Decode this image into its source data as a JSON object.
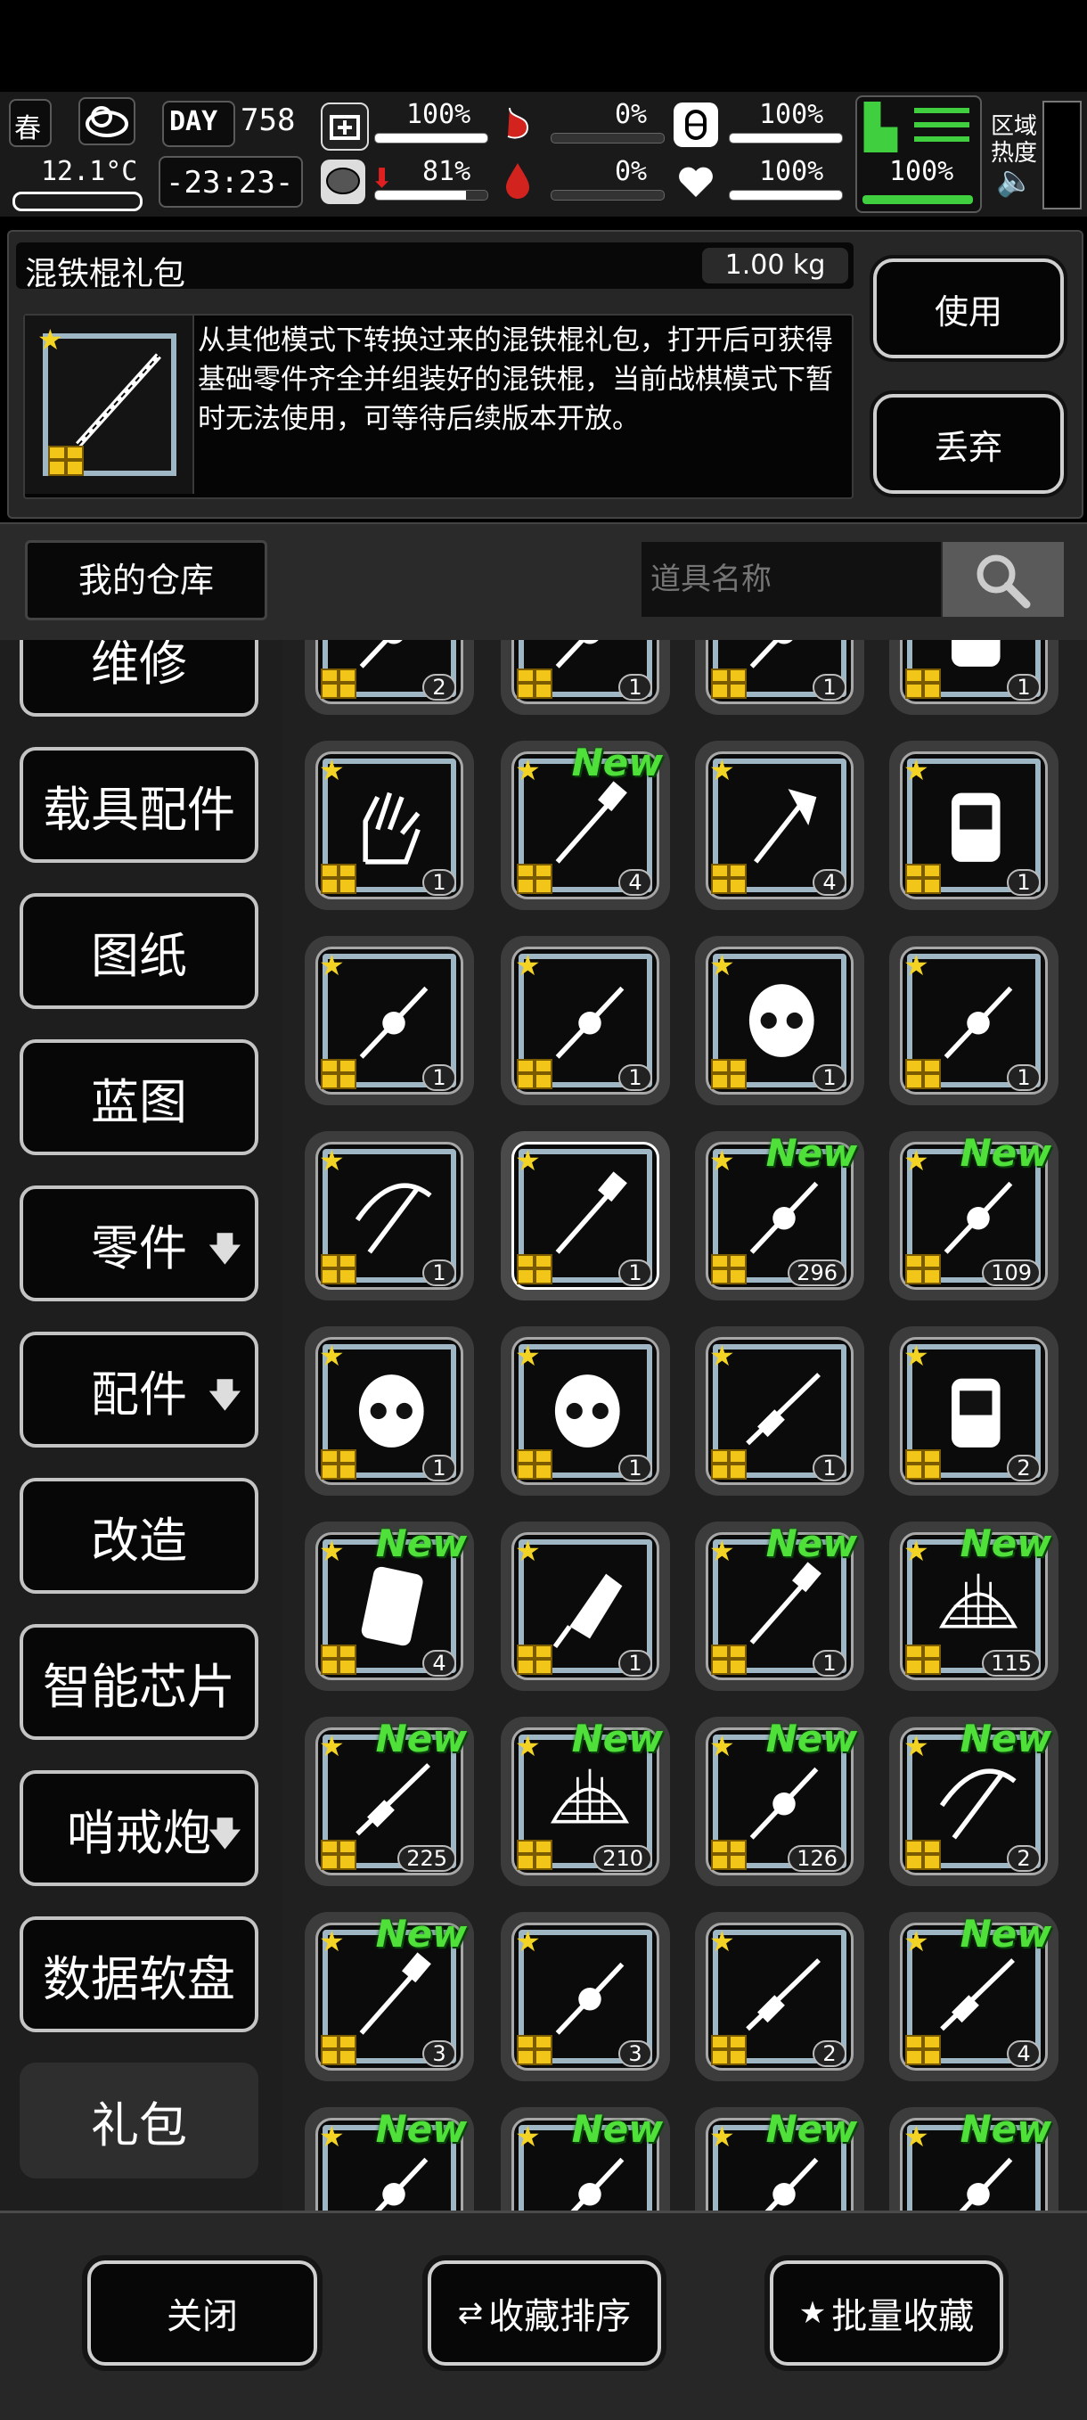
{
  "status": {
    "season": "春",
    "day_label": "DAY",
    "day": "758",
    "temperature": "12.1°C",
    "time": "-23:23-",
    "stats": [
      "100%",
      "0%",
      "100%",
      "81%",
      "0%",
      "100%"
    ],
    "stats_fill": [
      1.0,
      0.0,
      1.0,
      0.81,
      0.0,
      1.0
    ],
    "stamina": "100%",
    "zone_label": "区域",
    "heat_label": "热度"
  },
  "item": {
    "name": "混铁棍礼包",
    "weight": "1.00 kg",
    "description": "从其他模式下转换过来的混铁棍礼包，打开后可获得基础零件齐全并组装好的混铁棍，当前战棋模式下暂时无法使用，可等待后续版本开放。"
  },
  "actions": {
    "use": "使用",
    "discard": "丢弃"
  },
  "warehouse": {
    "title": "我的仓库",
    "search_placeholder": "道具名称"
  },
  "sidebar": [
    {
      "label": "维修",
      "arrow": ""
    },
    {
      "label": "载具配件",
      "arrow": ""
    },
    {
      "label": "图纸",
      "arrow": ""
    },
    {
      "label": "蓝图",
      "arrow": ""
    },
    {
      "label": "零件",
      "arrow": "🡇"
    },
    {
      "label": "配件",
      "arrow": "🡇"
    },
    {
      "label": "改造",
      "arrow": ""
    },
    {
      "label": "智能芯片",
      "arrow": ""
    },
    {
      "label": "哨戒炮",
      "arrow": "🡇"
    },
    {
      "label": "数据软盘",
      "arrow": ""
    },
    {
      "label": "礼包",
      "arrow": ""
    }
  ],
  "new_label": "New",
  "items": [
    {
      "icon": "chainsaw-icon",
      "count": "2",
      "new": false
    },
    {
      "icon": "golden-mace-icon",
      "count": "1",
      "new": false
    },
    {
      "icon": "rope-icon",
      "count": "1",
      "new": false
    },
    {
      "icon": "jacket-icon",
      "count": "1",
      "new": false
    },
    {
      "icon": "glove-icon",
      "count": "1",
      "new": false
    },
    {
      "icon": "shovel-icon",
      "count": "4",
      "new": true
    },
    {
      "icon": "axe-icon",
      "count": "4",
      "new": false
    },
    {
      "icon": "backpack-icon",
      "count": "1",
      "new": false
    },
    {
      "icon": "wrench-blade-icon",
      "count": "1",
      "new": false
    },
    {
      "icon": "crossed-tools-icon",
      "count": "1",
      "new": false
    },
    {
      "icon": "skull-mask-icon",
      "count": "1",
      "new": false
    },
    {
      "icon": "drill-icon",
      "count": "1",
      "new": false
    },
    {
      "icon": "crossbow-icon",
      "count": "1",
      "new": false
    },
    {
      "icon": "iron-staff-icon",
      "count": "1",
      "new": false
    },
    {
      "icon": "spiked-club-icon",
      "count": "296",
      "new": true
    },
    {
      "icon": "flashlight-icon",
      "count": "109",
      "new": true
    },
    {
      "icon": "helmet-icon",
      "count": "1",
      "new": false
    },
    {
      "icon": "gas-mask-icon",
      "count": "1",
      "new": false
    },
    {
      "icon": "rifle-icon",
      "count": "1",
      "new": false
    },
    {
      "icon": "military-pack-icon",
      "count": "2",
      "new": false
    },
    {
      "icon": "riot-shield-icon",
      "count": "4",
      "new": true
    },
    {
      "icon": "cleaver-icon",
      "count": "1",
      "new": false
    },
    {
      "icon": "bat-icon",
      "count": "1",
      "new": true
    },
    {
      "icon": "net-icon",
      "count": "115",
      "new": true
    },
    {
      "icon": "grenade-launcher-icon",
      "count": "225",
      "new": true
    },
    {
      "icon": "net-trap-icon",
      "count": "210",
      "new": true
    },
    {
      "icon": "fire-canister-icon",
      "count": "126",
      "new": true
    },
    {
      "icon": "compound-bow-icon",
      "count": "2",
      "new": true
    },
    {
      "icon": "spear-icon",
      "count": "3",
      "new": true
    },
    {
      "icon": "chainsaw-large-icon",
      "count": "3",
      "new": false
    },
    {
      "icon": "minigun-icon",
      "count": "2",
      "new": false
    },
    {
      "icon": "flamethrower-icon",
      "count": "4",
      "new": true
    },
    {
      "icon": "weapon-icon",
      "count": "",
      "new": true
    },
    {
      "icon": "weapon-icon",
      "count": "",
      "new": true
    },
    {
      "icon": "weapon-icon",
      "count": "",
      "new": true
    },
    {
      "icon": "weapon-icon",
      "count": "",
      "new": true
    }
  ],
  "bottom": {
    "close": "关闭",
    "sort": "收藏排序",
    "batch": "批量收藏"
  }
}
